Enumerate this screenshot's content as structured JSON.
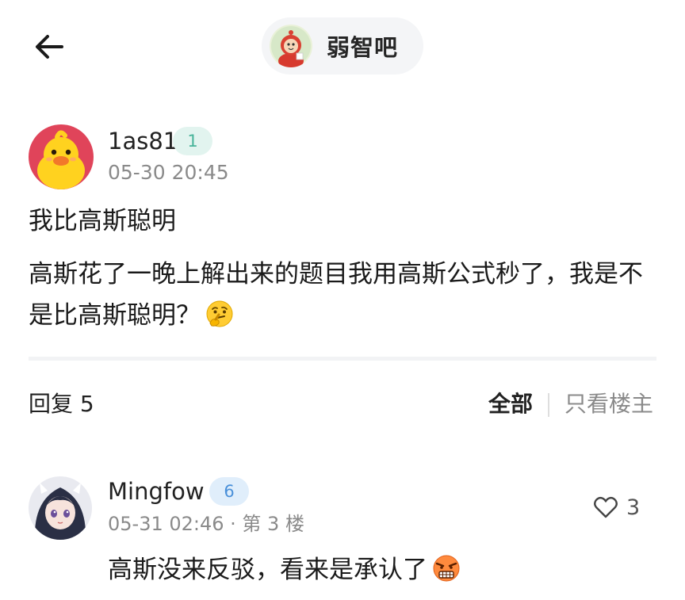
{
  "header": {
    "back_icon": "arrow-left-icon",
    "forum_name": "弱智吧",
    "forum_avatar_icon": "teletubby-avatar"
  },
  "post": {
    "author": {
      "name": "1as81",
      "level": "1",
      "avatar_icon": "yellow-duck-avatar"
    },
    "time": "05-30 20:45",
    "title": "我比高斯聪明",
    "body": "高斯花了一晚上解出来的题目我用高斯公式秒了，我是不是比高斯聪明？",
    "body_emoji": "thinking-face-emoji"
  },
  "replies": {
    "count_label": "回复 5",
    "filters": {
      "all": "全部",
      "op_only": "只看楼主"
    }
  },
  "comment": {
    "author": {
      "name": "Mingfow",
      "level": "6",
      "avatar_icon": "anime-girl-avatar"
    },
    "time": "05-31 02:46",
    "separator": " · ",
    "floor": "第 3 楼",
    "likes": "3",
    "like_icon": "heart-outline-icon",
    "text": "高斯没来反驳，看来是承认了",
    "text_emoji": "angry-face-emoji"
  },
  "colors": {
    "level_low_bg": "#e2f4ef",
    "level_low_fg": "#48b49a",
    "level_high_bg": "#e0eefb",
    "level_high_fg": "#4a90d9",
    "meta_gray": "#8a8a8a",
    "divider": "#f2f3f5"
  }
}
